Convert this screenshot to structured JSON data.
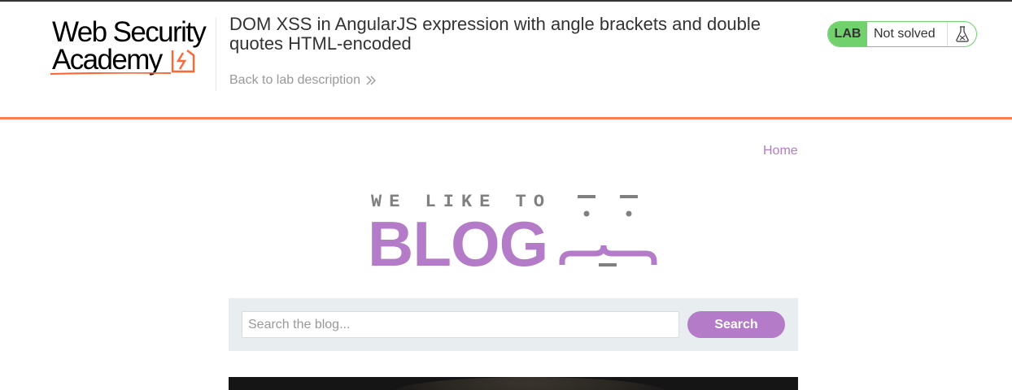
{
  "header": {
    "logo": {
      "line1": "Web Security",
      "line2": "Academy"
    },
    "lab_title": "DOM XSS in AngularJS expression with angle brackets and double quotes HTML-encoded",
    "back_link": "Back to lab description",
    "status": {
      "badge": "LAB",
      "label": "Not solved",
      "icon": "flask-icon"
    }
  },
  "colors": {
    "accent_orange": "#ff6633",
    "lab_green": "#70d16d",
    "blog_purple": "#b37bc8",
    "search_band": "#e8edf0"
  },
  "nav": {
    "home": "Home"
  },
  "blog_logo": {
    "tagline": "WE LIKE TO",
    "word": "BLOG"
  },
  "search": {
    "placeholder": "Search the blog...",
    "value": "",
    "button": "Search"
  }
}
